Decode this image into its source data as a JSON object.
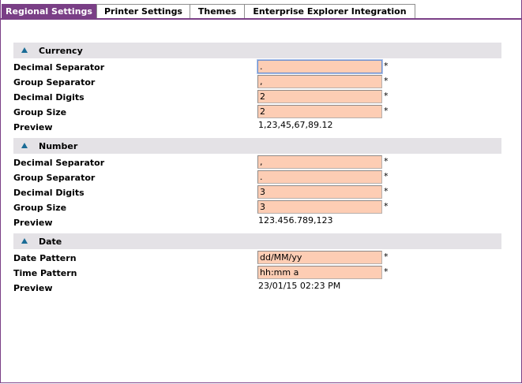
{
  "tabs": [
    {
      "label": "Regional Settings",
      "active": true
    },
    {
      "label": "Printer Settings",
      "active": false
    },
    {
      "label": "Themes",
      "active": false
    },
    {
      "label": "Enterprise Explorer Integration",
      "active": false
    }
  ],
  "required_mark": "*",
  "currency": {
    "title": "Currency",
    "decimal_separator_label": "Decimal Separator",
    "decimal_separator_value": ".",
    "group_separator_label": "Group Separator",
    "group_separator_value": ",",
    "decimal_digits_label": "Decimal Digits",
    "decimal_digits_value": "2",
    "group_size_label": "Group Size",
    "group_size_value": "2",
    "preview_label": "Preview",
    "preview_value": "1,23,45,67,89.12"
  },
  "number": {
    "title": "Number",
    "decimal_separator_label": "Decimal Separator",
    "decimal_separator_value": ",",
    "group_separator_label": "Group Separator",
    "group_separator_value": ".",
    "decimal_digits_label": "Decimal Digits",
    "decimal_digits_value": "3",
    "group_size_label": "Group Size",
    "group_size_value": "3",
    "preview_label": "Preview",
    "preview_value": "123.456.789,123"
  },
  "date": {
    "title": "Date",
    "date_pattern_label": "Date Pattern",
    "date_pattern_value": "dd/MM/yy",
    "time_pattern_label": "Time Pattern",
    "time_pattern_value": "hh:mm a",
    "preview_label": "Preview",
    "preview_value": "23/01/15 02:23 PM"
  },
  "colors": {
    "accent": "#7a3f86",
    "field_bg": "#fdcdb4",
    "section_bg": "#e4e2e6",
    "triangle": "#1a6c96"
  }
}
